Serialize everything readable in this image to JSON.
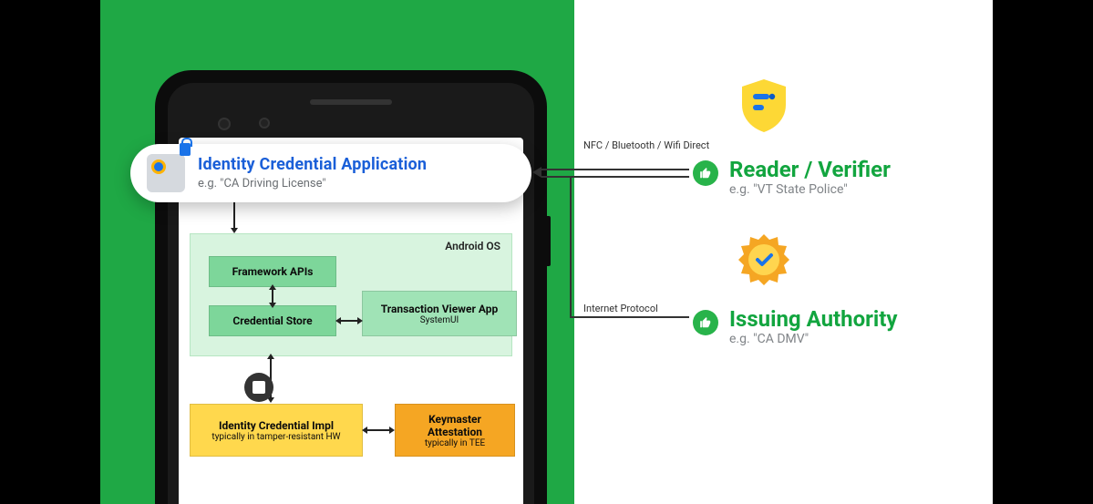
{
  "pill": {
    "title": "Identity Credential Application",
    "subtitle": "e.g. \"CA Driving License\""
  },
  "os": {
    "label": "Android OS",
    "framework_apis": "Framework APIs",
    "credential_store": "Credential Store",
    "tx_viewer": "Transaction Viewer App",
    "tx_viewer_sub": "SystemUI"
  },
  "impl": {
    "box_title": "Identity Credential Impl",
    "box_sub": "typically in tamper-resistant HW",
    "km_title": "Keymaster Attestation",
    "km_sub": "typically in TEE"
  },
  "connectors": {
    "nfc": "NFC / Bluetooth / Wifi Direct",
    "ip": "Internet Protocol"
  },
  "reader": {
    "title": "Reader / Verifier",
    "subtitle": "e.g. \"VT State Police\""
  },
  "issuer": {
    "title": "Issuing Authority",
    "subtitle": "e.g. \"CA DMV\""
  }
}
